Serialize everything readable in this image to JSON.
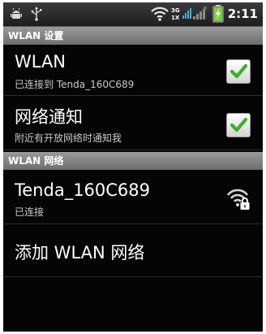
{
  "status_bar": {
    "time": "2:11",
    "icons": [
      "android-debug-icon",
      "usb-icon",
      "wifi-icon",
      "network-3g-icon",
      "signal-icon",
      "battery-charging-icon"
    ],
    "network_top": "3G",
    "network_bottom": "1X"
  },
  "wlan_settings": {
    "header": "WLAN 设置",
    "wlan_toggle": {
      "title": "WLAN",
      "summary": "已连接到 Tenda_160C689",
      "checked": true
    },
    "notify_toggle": {
      "title": "网络通知",
      "summary": "附近有开放网络时通知我",
      "checked": true
    }
  },
  "wlan_networks": {
    "header": "WLAN 网络",
    "items": [
      {
        "ssid": "Tenda_160C689",
        "status": "已连接",
        "icon": "wifi-lock-icon"
      }
    ],
    "add_network": "添加 WLAN 网络"
  },
  "colors": {
    "check": "#3fae2a",
    "battery": "#7cd13b",
    "signal": "#4aa9e0",
    "background": "#050505"
  }
}
